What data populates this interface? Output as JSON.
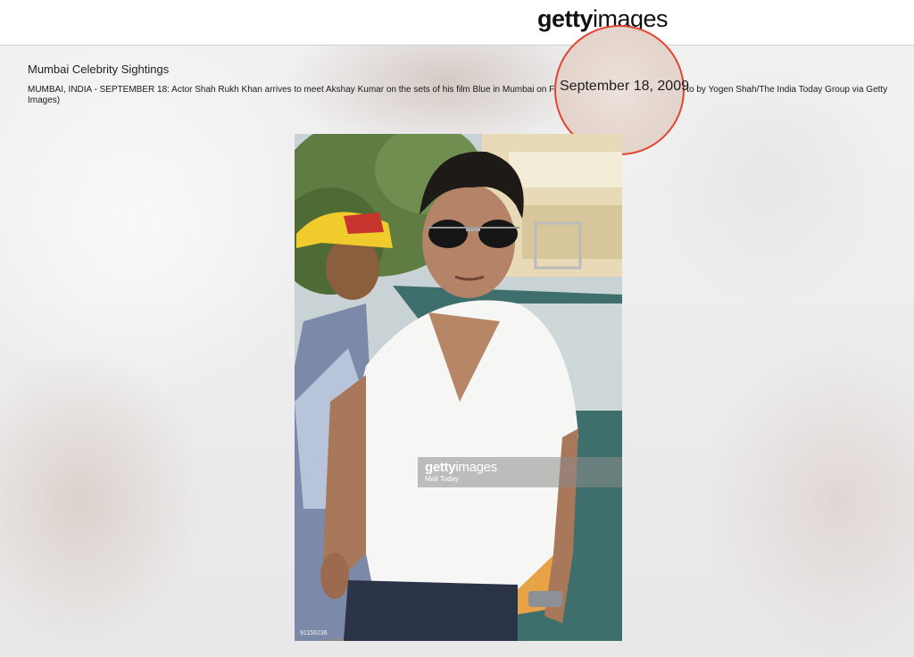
{
  "header": {
    "logo_bold": "getty",
    "logo_thin": "images"
  },
  "article": {
    "title": "Mumbai Celebrity Sightings",
    "caption": "MUMBAI, INDIA - SEPTEMBER 18: Actor Shah Rukh Khan arrives to meet Akshay Kumar on the sets of his film Blue in Mumbai on F",
    "caption_hidden_tail": "to by Yogen Shah/The India Today Group via Getty Images)",
    "highlighted_date": "September 18, 2009"
  },
  "photo": {
    "watermark_logo_bold": "getty",
    "watermark_logo_thin": "images",
    "watermark_credit": "Mail Today",
    "image_id": "91155236"
  },
  "colors": {
    "highlight_circle": "#e0462f",
    "topbar": "#ffffff"
  }
}
